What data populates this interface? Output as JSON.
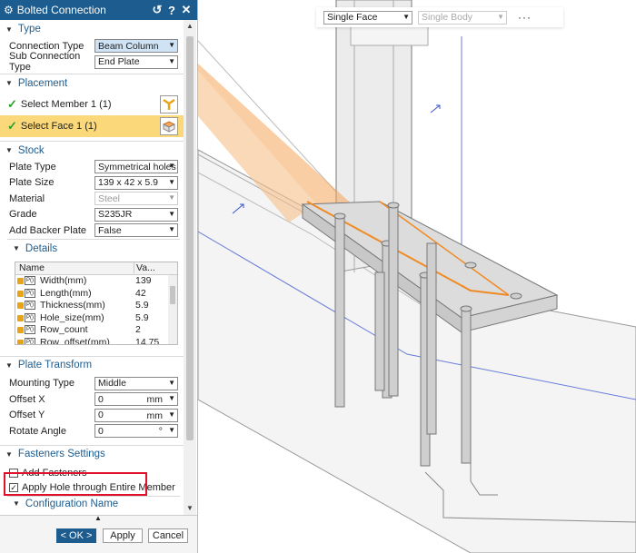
{
  "dialog": {
    "title": "Bolted Connection",
    "title_buttons": [
      "↺",
      "?",
      "✕"
    ],
    "sections": {
      "type": {
        "title": "Type",
        "connection_type_label": "Connection Type",
        "connection_type_value": "Beam Column",
        "sub_connection_type_label": "Sub Connection Type",
        "sub_connection_type_value": "End Plate"
      },
      "placement": {
        "title": "Placement",
        "select_member": "Select Member 1 (1)",
        "select_face": "Select Face 1 (1)"
      },
      "stock": {
        "title": "Stock",
        "plate_type_label": "Plate Type",
        "plate_type_value": "Symmetrical holes p",
        "plate_size_label": "Plate Size",
        "plate_size_value": "139 x 42 x 5.9",
        "material_label": "Material",
        "material_value": "Steel",
        "grade_label": "Grade",
        "grade_value": "S235JR",
        "backer_label": "Add Backer Plate",
        "backer_value": "False",
        "details": {
          "title": "Details",
          "col_name": "Name",
          "col_value": "Va...",
          "rows": [
            {
              "name": "Width(mm)",
              "value": "139"
            },
            {
              "name": "Length(mm)",
              "value": "42"
            },
            {
              "name": "Thickness(mm)",
              "value": "5.9"
            },
            {
              "name": "Hole_size(mm)",
              "value": "5.9"
            },
            {
              "name": "Row_count",
              "value": "2"
            },
            {
              "name": "Row_offset(mm)",
              "value": "14.75"
            }
          ]
        }
      },
      "plate_transform": {
        "title": "Plate Transform",
        "mounting_label": "Mounting Type",
        "mounting_value": "Middle",
        "offset_x_label": "Offset X",
        "offset_x_value": "0",
        "offset_x_unit": "mm",
        "offset_y_label": "Offset Y",
        "offset_y_value": "0",
        "offset_y_unit": "mm",
        "rotate_label": "Rotate Angle",
        "rotate_value": "0",
        "rotate_unit": "°"
      },
      "fasteners": {
        "title": "Fasteners Settings",
        "add_fasteners": "Add Fasteners",
        "add_fasteners_checked": false,
        "apply_hole": "Apply Hole through Entire Member",
        "apply_hole_checked": true
      },
      "configuration": {
        "title": "Configuration Name"
      }
    },
    "footer": {
      "ok": "< OK >",
      "apply": "Apply",
      "cancel": "Cancel"
    }
  },
  "viewport": {
    "face_filter": "Single Face",
    "body_filter": "Single Body",
    "more": "···"
  },
  "colors": {
    "titlebar": "#1d5c8e",
    "selection_highlight": "#fbd87a",
    "callout_red": "#e0102a",
    "plate_orange": "#f5a65b"
  }
}
